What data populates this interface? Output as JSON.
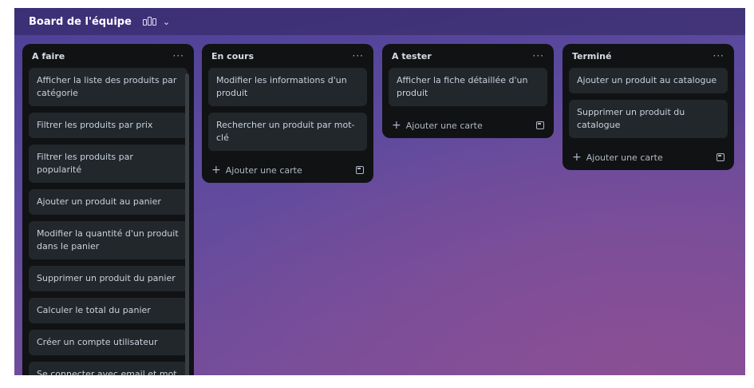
{
  "board": {
    "title": "Board de l'équipe",
    "view_icon": "board-view-icon",
    "chevron": "⌄"
  },
  "lists": [
    {
      "title": "A faire",
      "more": "···",
      "cards": [
        "Afficher la liste des produits par catégorie",
        "Filtrer les produits par prix",
        "Filtrer les produits par popularité",
        "Ajouter un produit au panier",
        "Modifier la quantité d'un produit dans le panier",
        "Supprimer un produit du panier",
        "Calculer le total du panier",
        "Créer un compte utilisateur",
        "Se connecter avec email et mot de passe"
      ]
    },
    {
      "title": "En cours",
      "more": "···",
      "cards": [
        "Modifier les informations d'un produit",
        "Rechercher un produit par mot-clé"
      ],
      "add_label": "Ajouter une carte"
    },
    {
      "title": "A tester",
      "more": "···",
      "cards": [
        "Afficher la fiche détaillée d'un produit"
      ],
      "add_label": "Ajouter une carte"
    },
    {
      "title": "Terminé",
      "more": "···",
      "cards": [
        "Ajouter un produit au catalogue",
        "Supprimer un produit du catalogue"
      ],
      "add_label": "Ajouter une carte"
    }
  ],
  "icons": {
    "add": "plus-icon",
    "template": "card-template-icon",
    "more": "more-options-icon"
  }
}
